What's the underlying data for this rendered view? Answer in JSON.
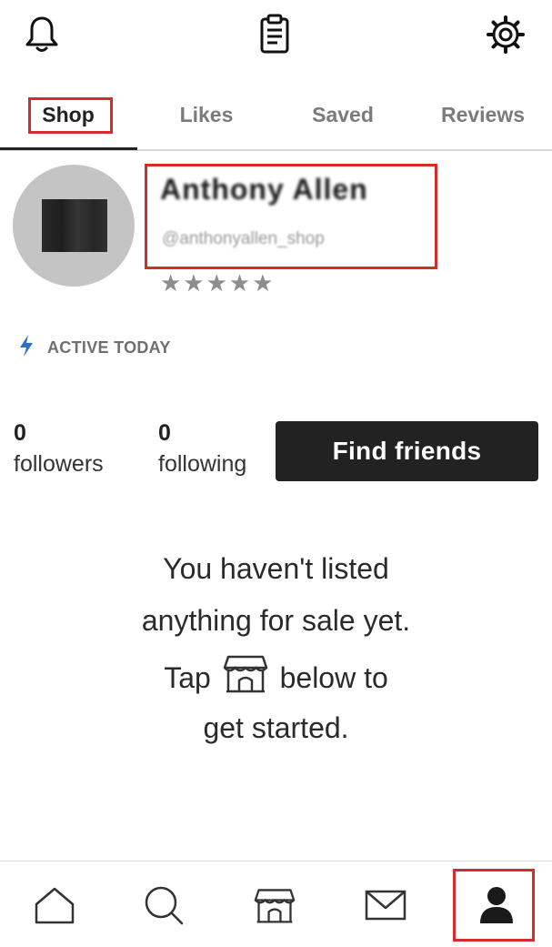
{
  "top_bar": {
    "icons": [
      "bell-icon",
      "clipboard-icon",
      "gear-icon"
    ]
  },
  "tabs": [
    {
      "label": "Shop",
      "active": true
    },
    {
      "label": "Likes",
      "active": false
    },
    {
      "label": "Saved",
      "active": false
    },
    {
      "label": "Reviews",
      "active": false
    }
  ],
  "profile": {
    "display_name": "Anthony Allen",
    "username": "@anthonyallen_shop",
    "rating_stars": "★★★★★",
    "active_status": "ACTIVE TODAY",
    "active_icon": "lightning-bolt-icon"
  },
  "stats": {
    "followers_count": "0",
    "followers_label": "followers",
    "following_count": "0",
    "following_label": "following"
  },
  "find_friends_label": "Find friends",
  "empty_state": {
    "line1": "You haven't listed",
    "line2": "anything for sale yet.",
    "line3_before": "Tap",
    "line3_after": "below to",
    "line4": "get started."
  },
  "bottom_nav": {
    "items": [
      "home-icon",
      "search-icon",
      "storefront-icon",
      "mail-icon",
      "person-icon"
    ],
    "active": "person-icon"
  },
  "colors": {
    "text": "#222222",
    "muted": "#7b7b7b",
    "accent_bolt": "#2a6fc9",
    "highlight": "#d52b2b",
    "button_bg": "#222222",
    "avatar_bg": "#c4c4c4"
  }
}
